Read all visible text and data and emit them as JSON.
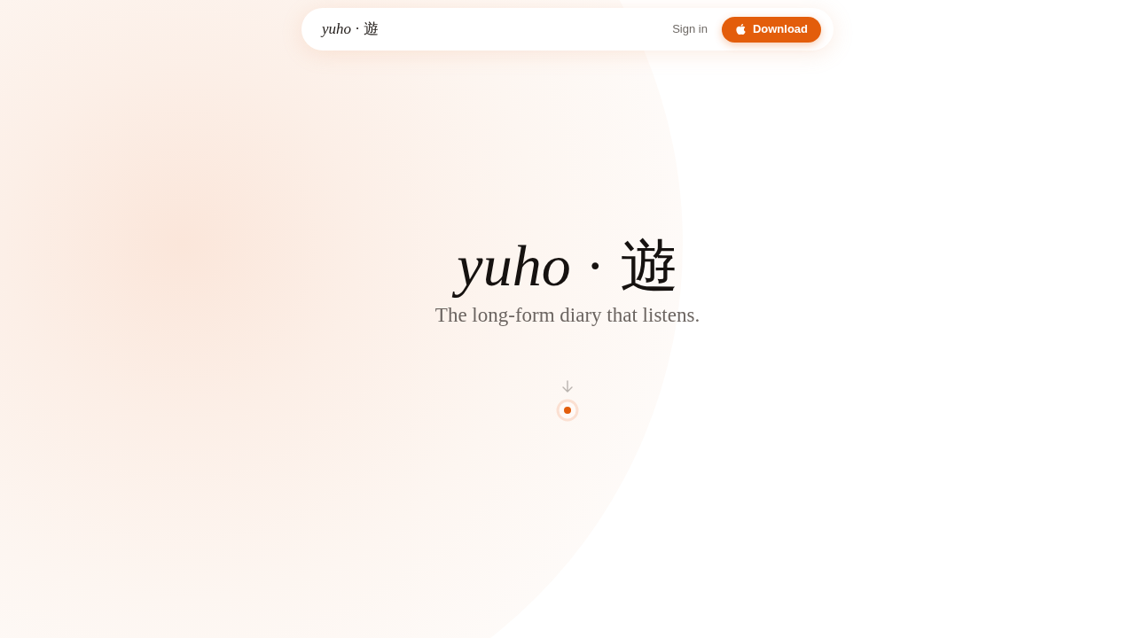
{
  "nav": {
    "logo": "*yuho* · 遊",
    "sign_in": "Sign in",
    "download_button": "Download"
  },
  "hero": {
    "title": "*yuho* · 遊",
    "tagline": "The long-form diary that listens."
  }
}
